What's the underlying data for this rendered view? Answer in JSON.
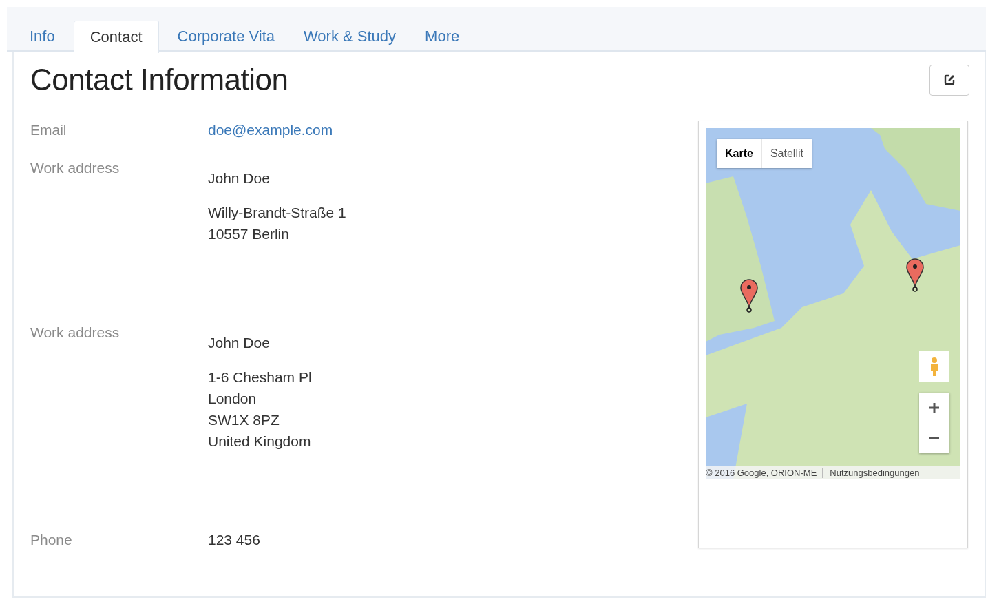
{
  "tabs": [
    {
      "label": "Info",
      "selected": false
    },
    {
      "label": "Contact",
      "selected": true
    },
    {
      "label": "Corporate Vita",
      "selected": false
    },
    {
      "label": "Work & Study",
      "selected": false
    },
    {
      "label": "More",
      "selected": false
    }
  ],
  "heading": "Contact Information",
  "fields": [
    {
      "kind": "email",
      "label": "Email",
      "value": "doe@example.com"
    },
    {
      "kind": "address",
      "label": "Work address",
      "name": "John Doe",
      "lines": [
        "Willy-Brandt-Straße 1",
        "10557 Berlin"
      ]
    },
    {
      "kind": "address",
      "label": "Work address",
      "name": "John Doe",
      "lines": [
        "1-6 Chesham Pl",
        "London",
        "SW1X 8PZ",
        "United Kingdom"
      ]
    },
    {
      "kind": "text",
      "label": "Phone",
      "value": "123 456"
    }
  ],
  "map": {
    "types": [
      {
        "label": "Karte",
        "selected": true
      },
      {
        "label": "Satellit",
        "selected": false
      }
    ],
    "copyright": "© 2016 Google, ORION-ME",
    "terms": "Nutzungsbedingungen"
  }
}
